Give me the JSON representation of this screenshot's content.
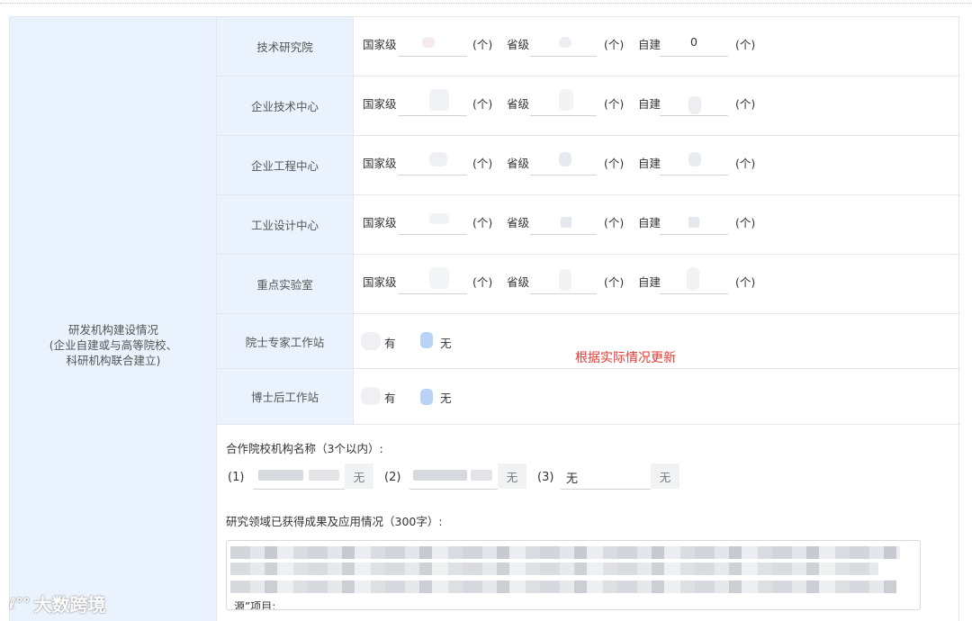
{
  "left_label": [
    "研发机构建设情况",
    "(企业自建或与高等院校、",
    "科研机构联合建立)"
  ],
  "level_labels": {
    "national": "国家级",
    "provincial": "省级",
    "self": "自建"
  },
  "unit": "(个)",
  "rows": [
    {
      "label": "技术研究院",
      "self_value": "0"
    },
    {
      "label": "企业技术中心",
      "self_value": ""
    },
    {
      "label": "企业工程中心",
      "self_value": ""
    },
    {
      "label": "工业设计中心",
      "self_value": ""
    },
    {
      "label": "重点实验室",
      "self_value": ""
    }
  ],
  "stations": [
    {
      "label": "院士专家工作站",
      "yes": "有",
      "no": "无",
      "selected": "无"
    },
    {
      "label": "博士后工作站",
      "yes": "有",
      "no": "无",
      "selected": "无"
    }
  ],
  "note": "根据实际情况更新",
  "cooperation": {
    "title": "合作院校机构名称（3个以内）:",
    "items": [
      {
        "index": "(1)",
        "value": "",
        "tag": "无"
      },
      {
        "index": "(2)",
        "value": "",
        "tag": "无"
      },
      {
        "index": "(3)",
        "value": "无",
        "tag": "无"
      }
    ]
  },
  "research": {
    "title": "研究领域已获得成果及应用情况（300字）:",
    "visible_tail": "源”项目;"
  },
  "watermark": "大数跨境",
  "colors": {
    "label_bg": "#eaf3fd",
    "note": "#e53935",
    "border": "#e3e6ec",
    "radio_selected": "#b8d3f5"
  }
}
